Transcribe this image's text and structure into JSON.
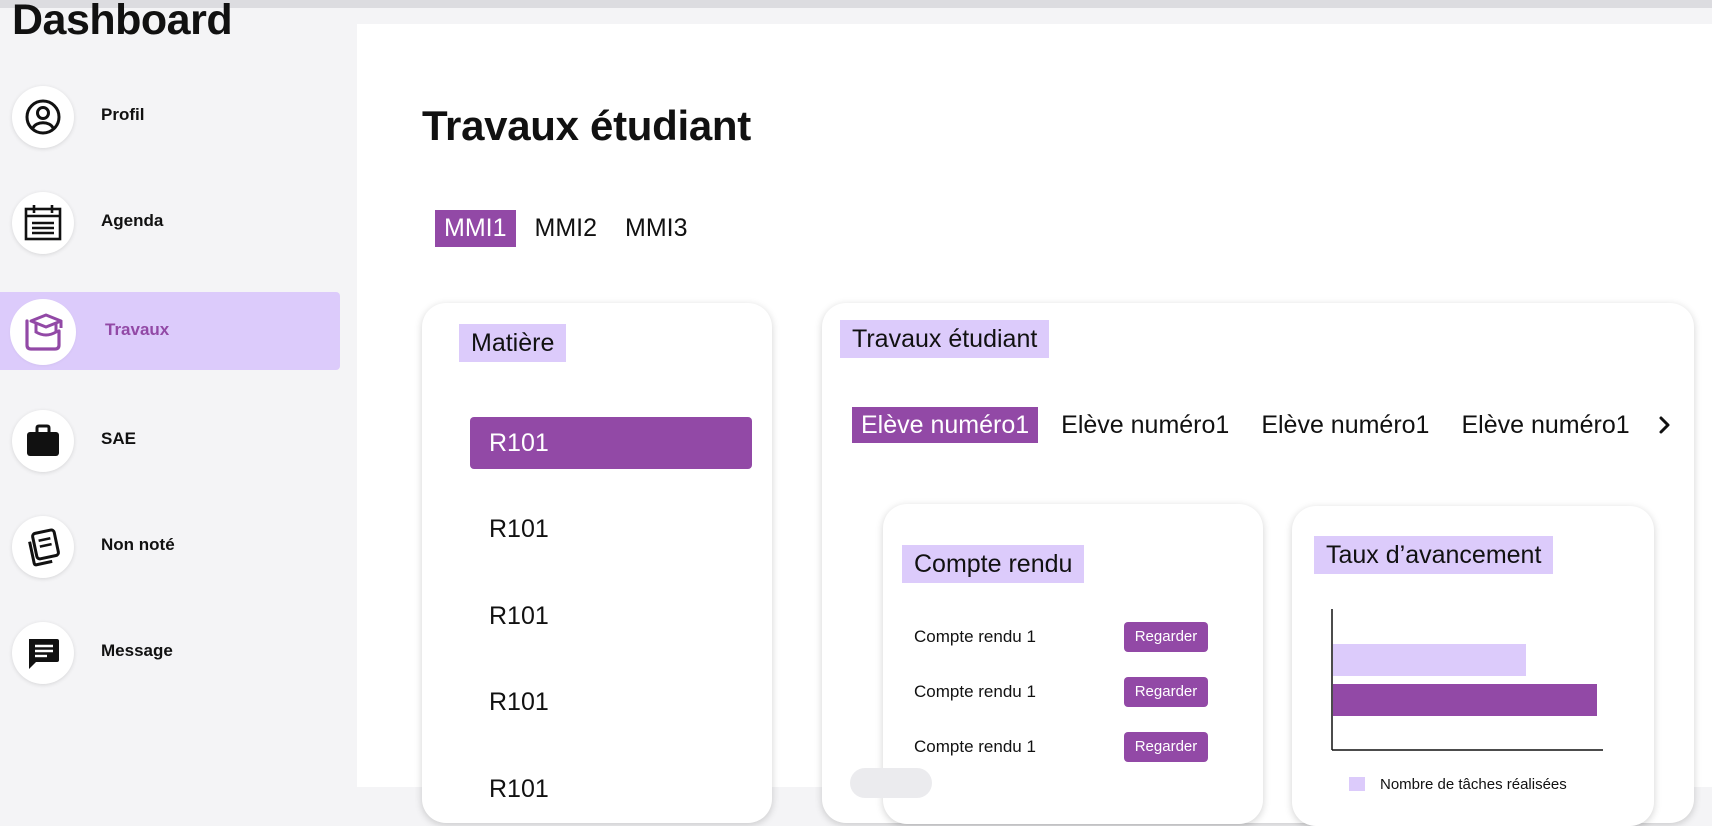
{
  "app": {
    "title": "Dashboard"
  },
  "sidebar": {
    "items": [
      {
        "label": "Profil",
        "icon": "user-circle-icon"
      },
      {
        "label": "Agenda",
        "icon": "calendar-icon"
      },
      {
        "label": "Travaux",
        "icon": "graduation-cap-icon",
        "active": true
      },
      {
        "label": "SAE",
        "icon": "briefcase-icon"
      },
      {
        "label": "Non noté",
        "icon": "notes-icon"
      },
      {
        "label": "Message",
        "icon": "message-icon"
      }
    ]
  },
  "main": {
    "title": "Travaux étudiant",
    "tabs": [
      {
        "label": "MMI1",
        "active": true
      },
      {
        "label": "MMI2"
      },
      {
        "label": "MMI3"
      }
    ],
    "subjects_panel": {
      "title": "Matière",
      "items": [
        "R101",
        "R101",
        "R101",
        "R101",
        "R101"
      ],
      "selected_index": 0
    },
    "work_panel": {
      "title": "Travaux étudiant",
      "students": [
        {
          "label": "Elève numéro1",
          "active": true
        },
        {
          "label": "Elève numéro1"
        },
        {
          "label": "Elève numéro1"
        },
        {
          "label": "Elève numéro1"
        }
      ],
      "next_icon": "chevron-right-icon",
      "reports": {
        "title": "Compte rendu",
        "rows": [
          {
            "label": "Compte rendu 1",
            "button": "Regarder"
          },
          {
            "label": "Compte rendu 1",
            "button": "Regarder"
          },
          {
            "label": "Compte rendu 1",
            "button": "Regarder"
          }
        ]
      },
      "progress": {
        "title": "Taux d’avancement",
        "legend": "Nombre de tâches réalisées"
      }
    }
  },
  "colors": {
    "accent": "#9249a6",
    "accent_light": "#dccbfb",
    "background": "#f4f4f6",
    "surface": "#ffffff"
  },
  "chart_data": {
    "type": "bar",
    "orientation": "horizontal",
    "series": [
      {
        "values": [
          0.73
        ],
        "color": "#dccbfb"
      },
      {
        "values": [
          1.0
        ],
        "color": "#9249a6"
      }
    ],
    "legend_entries": [
      "Nombre de tâches réalisées"
    ],
    "grid": false,
    "legend_position": "bottom"
  }
}
